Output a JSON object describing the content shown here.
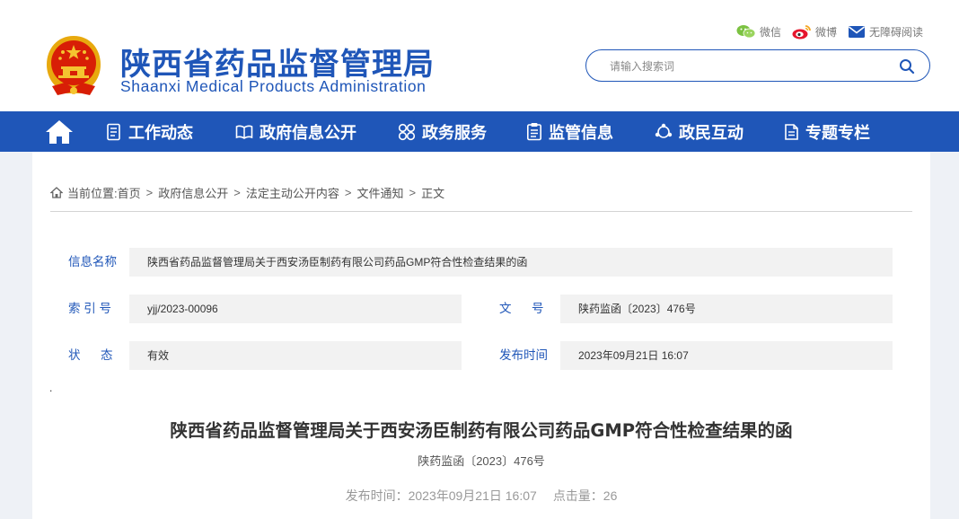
{
  "site": {
    "title": "陕西省药品监督管理局",
    "subtitle": "Shaanxi Medical Products Administration"
  },
  "top_links": {
    "wechat": "微信",
    "weibo": "微博",
    "accessibility": "无障碍阅读"
  },
  "search": {
    "placeholder": "请输入搜索词"
  },
  "nav": {
    "items": [
      {
        "label": "工作动态",
        "icon": "document-list-icon"
      },
      {
        "label": "政府信息公开",
        "icon": "open-book-icon"
      },
      {
        "label": "政务服务",
        "icon": "four-circles-icon"
      },
      {
        "label": "监管信息",
        "icon": "clipboard-icon"
      },
      {
        "label": "政民互动",
        "icon": "chat-exchange-icon"
      },
      {
        "label": "专题专栏",
        "icon": "folder-document-icon"
      }
    ]
  },
  "breadcrumb": {
    "prefix": "当前位置:",
    "items": [
      "首页",
      "政府信息公开",
      "法定主动公开内容",
      "文件通知",
      "正文"
    ],
    "separator": ">"
  },
  "meta": {
    "info_name_label": "信息名称",
    "info_name_value": "陕西省药品监督管理局关于西安汤臣制药有限公司药品GMP符合性检查结果的函",
    "index_label": "索 引 号",
    "index_value": "yjj/2023-00096",
    "doc_no_label": "文      号",
    "doc_no_value": "陕药监函〔2023〕476号",
    "status_label": "状      态",
    "status_value": "有效",
    "publish_time_label": "发布时间",
    "publish_time_value": "2023年09月21日 16:07"
  },
  "article": {
    "dot": ".",
    "title": "陕西省药品监督管理局关于西安汤臣制药有限公司药品GMP符合性检查结果的函",
    "doc_number": "陕药监函〔2023〕476号",
    "publish_time": "发布时间：2023年09月21日 16:07",
    "views": "点击量：26"
  },
  "colors": {
    "brand_blue": "#1f56b8",
    "page_bg": "#eef1f6",
    "field_bg": "#f2f2f2",
    "emblem_red": "#d81e06",
    "emblem_gold": "#f4c430"
  }
}
